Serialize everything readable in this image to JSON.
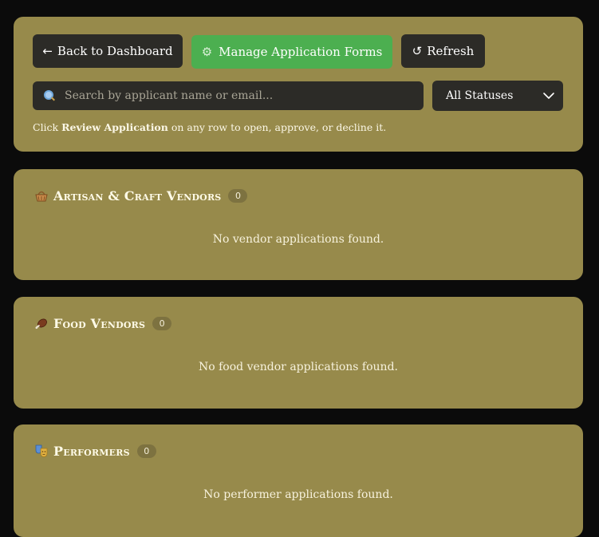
{
  "toolbar": {
    "back_label": "Back to Dashboard",
    "back_arrow": "←",
    "manage_label": "Manage Application Forms",
    "manage_icon": "gear-icon",
    "refresh_label": "Refresh",
    "refresh_icon": "↺",
    "search_placeholder": "Search by applicant name or email...",
    "status_selected": "All Statuses",
    "hint_prefix": "Click ",
    "hint_bold": "Review Application",
    "hint_suffix": " on any row to open, approve, or decline it."
  },
  "sections": {
    "artisan": {
      "title": "Artisan & Craft Vendors",
      "count": "0",
      "empty": "No vendor applications found.",
      "icon": "basket-icon"
    },
    "food": {
      "title": "Food Vendors",
      "count": "0",
      "empty": "No food vendor applications found.",
      "icon": "food-icon"
    },
    "performers": {
      "title": "Performers",
      "count": "0",
      "empty": "No performer applications found.",
      "icon": "theater-masks-icon"
    }
  },
  "colors": {
    "panel": "#978a4b",
    "background": "#0b0b0b",
    "button_dark": "#2c2b27",
    "accent_green": "#4caf50"
  }
}
